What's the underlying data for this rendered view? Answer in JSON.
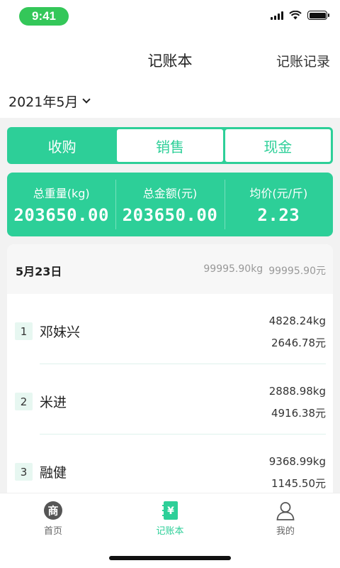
{
  "status": {
    "time": "9:41"
  },
  "nav": {
    "title": "记账本",
    "right_action": "记账记录"
  },
  "month": {
    "label": "2021年5月"
  },
  "tabs": [
    {
      "label": "收购",
      "active": true
    },
    {
      "label": "销售",
      "active": false
    },
    {
      "label": "现金",
      "active": false
    }
  ],
  "summary": [
    {
      "title": "总重量(kg)",
      "value": "203650.00"
    },
    {
      "title": "总金额(元)",
      "value": "203650.00"
    },
    {
      "title": "均价(元/斤)",
      "value": "2.23"
    }
  ],
  "day": {
    "date": "5月23日",
    "total_kg": "99995.90kg",
    "total_amount": "99995.90元"
  },
  "records": [
    {
      "rank": "1",
      "name": "邓妹兴",
      "kg": "4828.24kg",
      "amount": "2646.78元"
    },
    {
      "rank": "2",
      "name": "米进",
      "kg": "2888.98kg",
      "amount": "4916.38元"
    },
    {
      "rank": "3",
      "name": "融健",
      "kg": "9368.99kg",
      "amount": "1145.50元"
    }
  ],
  "tabbar": [
    {
      "label": "首页",
      "icon": "shop-icon",
      "glyph": "商",
      "active": false
    },
    {
      "label": "记账本",
      "icon": "ledger-icon",
      "glyph": "¥",
      "active": true
    },
    {
      "label": "我的",
      "icon": "profile-icon",
      "active": false
    }
  ],
  "colors": {
    "accent": "#2dcf98",
    "status_green": "#34c759"
  }
}
